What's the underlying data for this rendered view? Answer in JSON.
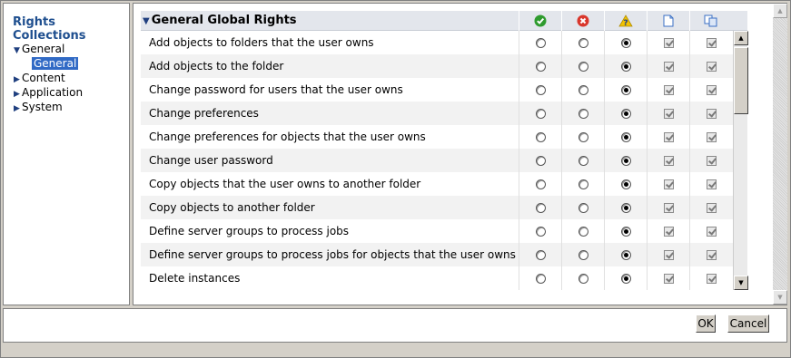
{
  "sidebar": {
    "title": "Rights Collections",
    "items": [
      {
        "label": "General",
        "expanded": true,
        "children": [
          "General"
        ]
      },
      {
        "label": "Content"
      },
      {
        "label": "Application"
      },
      {
        "label": "System"
      }
    ]
  },
  "main": {
    "section_title": "General Global Rights",
    "columns": [
      {
        "icon": "granted-check-icon",
        "color": "#2e9b2e"
      },
      {
        "icon": "denied-x-icon",
        "color": "#d9362b"
      },
      {
        "icon": "not-specified-question-icon",
        "color": "#e9b800"
      },
      {
        "icon": "apply-to-object-icon",
        "color": "#3a6fc4"
      },
      {
        "icon": "apply-to-subobjects-icon",
        "color": "#3a6fc4"
      }
    ],
    "rows": [
      {
        "label": "Add objects to folders that the user owns",
        "selected": 2
      },
      {
        "label": "Add objects to the folder",
        "selected": 2
      },
      {
        "label": "Change password for users that the user owns",
        "selected": 2
      },
      {
        "label": "Change preferences",
        "selected": 2
      },
      {
        "label": "Change preferences for objects that the user owns",
        "selected": 2
      },
      {
        "label": "Change user password",
        "selected": 2
      },
      {
        "label": "Copy objects that the user owns to another folder",
        "selected": 2
      },
      {
        "label": "Copy objects to another folder",
        "selected": 2
      },
      {
        "label": "Define server groups to process jobs",
        "selected": 2
      },
      {
        "label": "Define server groups to process jobs for objects that the user owns",
        "selected": 2
      },
      {
        "label": "Delete instances",
        "selected": 2
      }
    ]
  },
  "buttons": {
    "ok": "OK",
    "cancel": "Cancel"
  }
}
